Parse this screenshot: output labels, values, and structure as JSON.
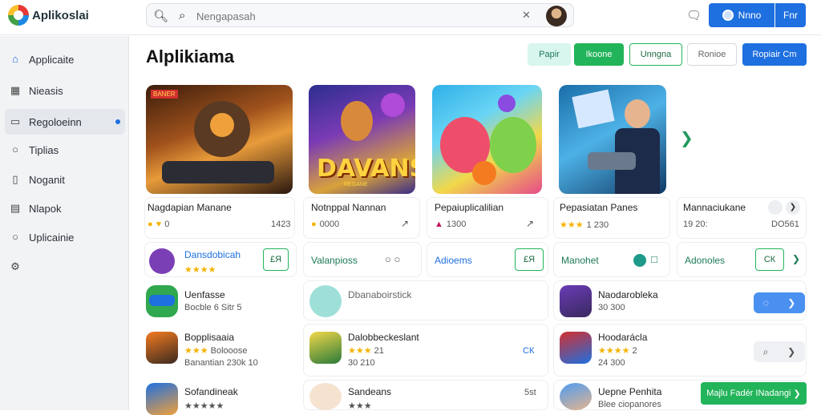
{
  "header": {
    "logo_text": "Aplikoslai",
    "search_placeholder": "Nengapasah",
    "clear_label": "✕",
    "btn_primary": "Nnno",
    "btn_secondary": "Fnr"
  },
  "sidebar": {
    "items": [
      {
        "label": "Applicaite",
        "icon": "home-icon"
      },
      {
        "label": "Nieasis",
        "icon": "calendar-icon"
      },
      {
        "label": "Regoloeinn",
        "icon": "window-icon",
        "active": true
      },
      {
        "label": "Tiplias",
        "icon": "chat-icon"
      },
      {
        "label": "Noganit",
        "icon": "document-icon"
      },
      {
        "label": "Nlapok",
        "icon": "bookmark-icon"
      },
      {
        "label": "Uplicainie",
        "icon": "bubble-icon"
      },
      {
        "label": "",
        "icon": "settings-icon"
      }
    ]
  },
  "main": {
    "title": "Alplikiama",
    "filters": [
      "Papir",
      "Ikoone",
      "Unngna",
      "Ronioe",
      "Ropiair Cm"
    ]
  },
  "featured": [
    {
      "title": "Nagdapian Manane",
      "meta": "0",
      "right": "1423",
      "badge": "BANER"
    },
    {
      "title": "Notnppal Nannan",
      "meta": "0000",
      "right": "",
      "big": "DAVANS",
      "sub": "REGANE"
    },
    {
      "title": "Pepaiuplicalilian",
      "meta": "1300",
      "right": ""
    },
    {
      "title": "Pepasiatan Panes",
      "meta": "1 230",
      "right": ""
    },
    {
      "title": "Mannaciukane",
      "meta": "19 20:",
      "right": "DO561"
    }
  ],
  "row2": [
    {
      "label": "Dansdobicah",
      "btn": "£Я"
    },
    {
      "label": "Valanpioss",
      "btn": ""
    },
    {
      "label": "Adioems",
      "btn": "£Я"
    },
    {
      "label": "Manohet",
      "btn": ""
    },
    {
      "label": "Adonoles",
      "btn": "СК"
    }
  ],
  "apps": [
    {
      "name": "Uenfasse",
      "sub": "Bocble 6 Sitr 5",
      "col": 0
    },
    {
      "name": "Dbanaboirstick",
      "sub": "",
      "col": 1
    },
    {
      "name": "Naodarobleka",
      "sub": "30 300",
      "col": 2
    },
    {
      "name": "Bopplisaaia",
      "sub": "Bolooose",
      "sub2": "Banantian 230k 10",
      "col": 0
    },
    {
      "name": "Dalobbeckeslant",
      "sub": "21",
      "sub2": "30 210",
      "col": 1,
      "right": "СК"
    },
    {
      "name": "Hoodarácla",
      "sub": "2",
      "sub2": "24 300",
      "col": 2
    },
    {
      "name": "Sofandineak",
      "sub": "",
      "col": 0
    },
    {
      "name": "Sandeans",
      "sub": "",
      "col": 1,
      "right": "5st"
    },
    {
      "name": "Uepne Penhita",
      "sub": "Blee ciopanores",
      "col": 2
    }
  ],
  "install_label": "Majlu Fadér INadangi",
  "colors": {
    "accent_blue": "#1e6fe0",
    "accent_green": "#22b45a",
    "star": "#f5b301"
  }
}
